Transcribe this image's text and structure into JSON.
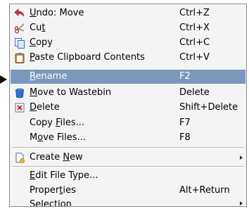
{
  "context_menu": {
    "items": [
      {
        "prefix": "",
        "mnemonic": "U",
        "suffix": "ndo: Move",
        "shortcut": "Ctrl+Z",
        "icon": "undo-icon"
      },
      {
        "prefix": "Cu",
        "mnemonic": "t",
        "suffix": "",
        "shortcut": "Ctrl+X",
        "icon": "cut-icon"
      },
      {
        "prefix": "",
        "mnemonic": "C",
        "suffix": "opy",
        "shortcut": "Ctrl+C",
        "icon": "copy-icon"
      },
      {
        "prefix": "",
        "mnemonic": "P",
        "suffix": "aste Clipboard Contents",
        "shortcut": "Ctrl+V",
        "icon": "paste-icon"
      },
      {
        "prefix": "",
        "mnemonic": "R",
        "suffix": "ename",
        "shortcut": "F2",
        "icon": ""
      },
      {
        "prefix": "",
        "mnemonic": "M",
        "suffix": "ove to Wastebin",
        "shortcut": "Delete",
        "icon": "wastebin-icon"
      },
      {
        "prefix": "",
        "mnemonic": "D",
        "suffix": "elete",
        "shortcut": "Shift+Delete",
        "icon": "delete-icon"
      },
      {
        "prefix": "Copy ",
        "mnemonic": "F",
        "suffix": "iles...",
        "shortcut": "F7",
        "icon": ""
      },
      {
        "prefix": "M",
        "mnemonic": "o",
        "suffix": "ve Files...",
        "shortcut": "F8",
        "icon": ""
      },
      {
        "prefix": "Create ",
        "mnemonic": "N",
        "suffix": "ew",
        "shortcut": "",
        "icon": "create-new-icon",
        "submenu": true
      },
      {
        "prefix": "",
        "mnemonic": "E",
        "suffix": "dit File Type...",
        "shortcut": "",
        "icon": ""
      },
      {
        "prefix": "Proper",
        "mnemonic": "t",
        "suffix": "ies",
        "shortcut": "Alt+Return",
        "icon": ""
      },
      {
        "prefix": "Selection",
        "mnemonic": "",
        "suffix": "",
        "shortcut": "",
        "icon": "",
        "submenu": true
      }
    ],
    "highlighted_item": "Rename",
    "colors": {
      "background": "#f4f4f4",
      "highlight": "#7a98bb",
      "highlight_text": "#ffffff",
      "border": "#8a8a8a"
    }
  }
}
